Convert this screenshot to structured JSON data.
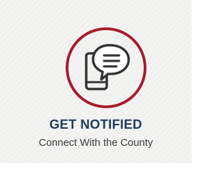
{
  "card": {
    "title": "GET NOTIFIED",
    "subtitle": "Connect With the County",
    "icon": "phone-message-icon"
  },
  "colors": {
    "ring": "#a61c2c",
    "title": "#1f3c5a",
    "icon_stroke": "#333333",
    "background": "#f0f0ef"
  }
}
